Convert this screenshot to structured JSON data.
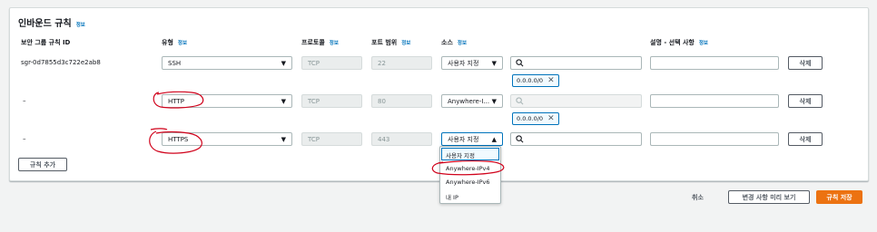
{
  "panel": {
    "title": "인바운드 규칙",
    "info": "정보"
  },
  "headers": {
    "rule_id": "보안 그룹 규칙 ID",
    "type": "유형",
    "type_info": "정보",
    "protocol": "프로토콜",
    "protocol_info": "정보",
    "port": "포트 범위",
    "port_info": "정보",
    "source": "소스",
    "source_info": "정보",
    "desc": "설명 - 선택 사항",
    "desc_info": "정보"
  },
  "rows": [
    {
      "id": "sgr-0d7855d3c722e2ab8",
      "type": "SSH",
      "protocol": "TCP",
      "port": "22",
      "source": "사용자 지정",
      "token": "0.0.0.0/0",
      "delete": "삭제"
    },
    {
      "id": "–",
      "type": "HTTP",
      "protocol": "TCP",
      "port": "80",
      "source": "Anywhere-I...",
      "token": "0.0.0.0/0",
      "delete": "삭제"
    },
    {
      "id": "–",
      "type": "HTTPS",
      "protocol": "TCP",
      "port": "443",
      "source": "사용자 지정",
      "delete": "삭제"
    }
  ],
  "search_placeholder": "",
  "dropdown_options": [
    "사용자 지정",
    "Anywhere-IPv4",
    "Anywhere-IPv6",
    "내 IP"
  ],
  "add_rule": "규칙 추가",
  "footer": {
    "cancel": "취소",
    "preview": "변경 사항 미리 보기",
    "save": "규칙 저장"
  },
  "colors": {
    "accent": "#ec7211",
    "link": "#0073bb",
    "annotation": "#d0021b"
  }
}
